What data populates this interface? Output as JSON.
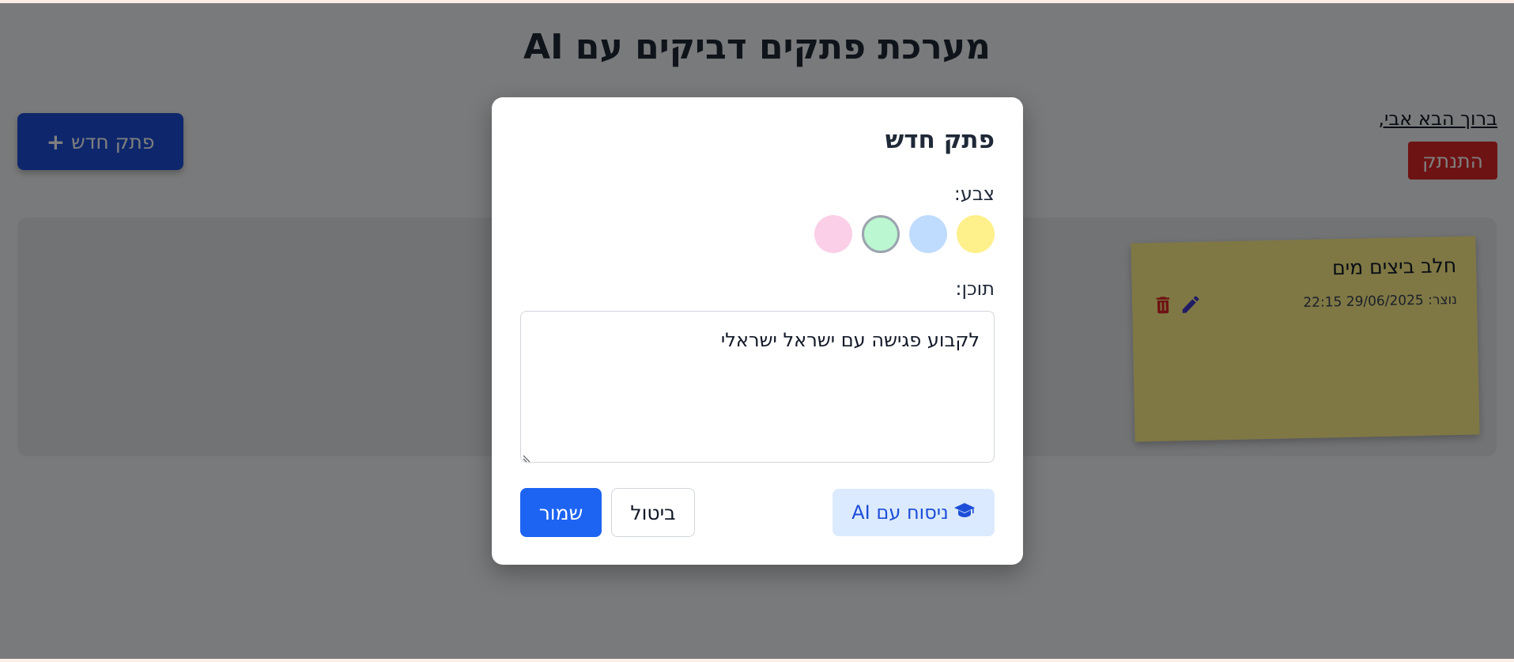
{
  "header": {
    "title": "מערכת פתקים דביקים עם AI"
  },
  "user": {
    "welcome": "ברוך הבא אבי,",
    "logout_label": "התנתק"
  },
  "toolbar": {
    "new_note_label": "פתק חדש",
    "new_note_icon": "plus-icon"
  },
  "notes": [
    {
      "title": "חלב ביצים מים",
      "created": "נוצר: 29/06/2025 22:15",
      "color": "#fef08a",
      "icons": [
        "pencil-icon",
        "trash-icon"
      ]
    }
  ],
  "modal": {
    "title": "פתק חדש",
    "color_label": "צבע:",
    "colors": [
      {
        "name": "yellow",
        "hex": "#fef08a",
        "selected": false
      },
      {
        "name": "blue",
        "hex": "#bfdbfe",
        "selected": false
      },
      {
        "name": "green",
        "hex": "#bbf7d0",
        "selected": true
      },
      {
        "name": "pink",
        "hex": "#fbcfe8",
        "selected": false
      }
    ],
    "content_label": "תוכן:",
    "content_value": "לקבוע פגישה עם ישראל ישראלי",
    "ai_button_label": "ניסוח עם AI",
    "ai_button_icon": "graduation-cap-icon",
    "cancel_label": "ביטול",
    "save_label": "שמור"
  },
  "colors": {
    "primary": "#1d64f2",
    "danger": "#dc2626",
    "overlay": "rgba(0,0,0,0.5)"
  }
}
